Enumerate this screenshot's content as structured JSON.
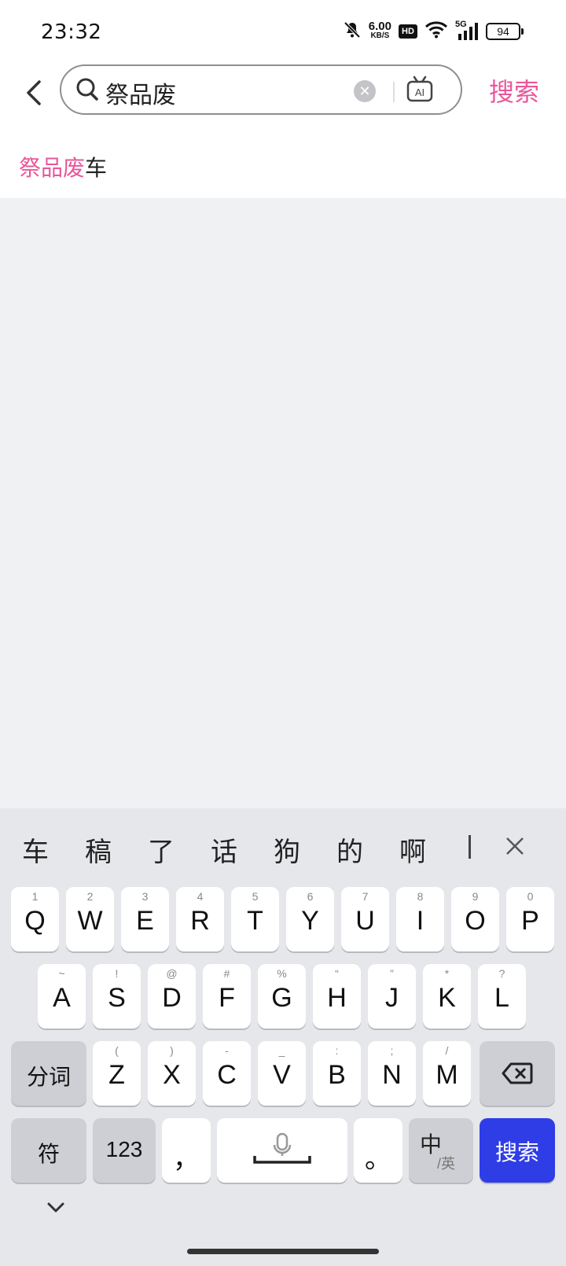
{
  "status_bar": {
    "time": "23:32",
    "net_speed_value": "6.00",
    "net_speed_unit": "KB/S",
    "hd_label": "HD",
    "network_label": "5G",
    "battery": "94"
  },
  "search": {
    "query": "祭品废",
    "search_button": "搜索",
    "ai_label": "AI"
  },
  "suggestions": [
    {
      "highlight": "祭品废",
      "rest": "车"
    }
  ],
  "keyboard": {
    "candidates": [
      "车",
      "稿",
      "了",
      "话",
      "狗",
      "的",
      "啊"
    ],
    "row1": [
      {
        "sub": "1",
        "main": "Q"
      },
      {
        "sub": "2",
        "main": "W"
      },
      {
        "sub": "3",
        "main": "E"
      },
      {
        "sub": "4",
        "main": "R"
      },
      {
        "sub": "5",
        "main": "T"
      },
      {
        "sub": "6",
        "main": "Y"
      },
      {
        "sub": "7",
        "main": "U"
      },
      {
        "sub": "8",
        "main": "I"
      },
      {
        "sub": "9",
        "main": "O"
      },
      {
        "sub": "0",
        "main": "P"
      }
    ],
    "row2": [
      {
        "sub": "~",
        "main": "A"
      },
      {
        "sub": "!",
        "main": "S"
      },
      {
        "sub": "@",
        "main": "D"
      },
      {
        "sub": "#",
        "main": "F"
      },
      {
        "sub": "%",
        "main": "G"
      },
      {
        "sub": "“",
        "main": "H"
      },
      {
        "sub": "”",
        "main": "J"
      },
      {
        "sub": "*",
        "main": "K"
      },
      {
        "sub": "?",
        "main": "L"
      }
    ],
    "row3": [
      {
        "sub": "(",
        "main": "Z"
      },
      {
        "sub": ")",
        "main": "X"
      },
      {
        "sub": "-",
        "main": "C"
      },
      {
        "sub": "_",
        "main": "V"
      },
      {
        "sub": ":",
        "main": "B"
      },
      {
        "sub": ";",
        "main": "N"
      },
      {
        "sub": "/",
        "main": "M"
      }
    ],
    "segment_key": "分词",
    "symbols_key": "符",
    "numbers_key": "123",
    "comma_key": "，",
    "period_key": "。",
    "lang_key_main": "中",
    "lang_key_sub": "/英",
    "enter_key": "搜索"
  },
  "colors": {
    "accent_pink": "#E9579A",
    "enter_blue": "#2F3DE6"
  }
}
